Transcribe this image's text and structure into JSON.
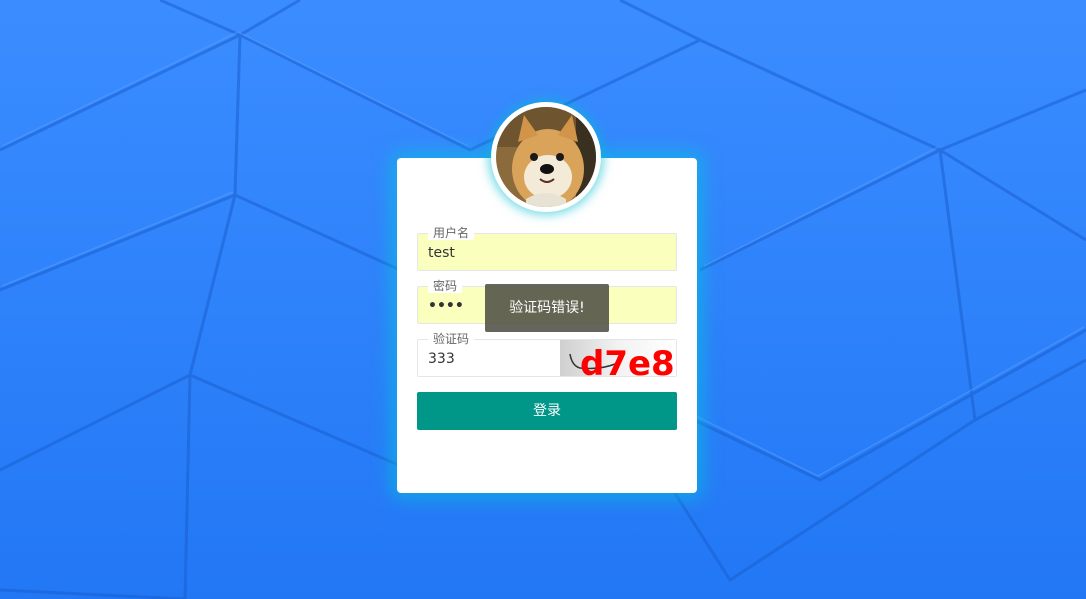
{
  "login_form": {
    "username": {
      "legend": "用户名",
      "value": "test"
    },
    "password": {
      "legend": "密码",
      "value": "••••"
    },
    "captcha": {
      "legend": "验证码",
      "value": "333",
      "image_text": "d7e8"
    },
    "submit_label": "登录"
  },
  "toast": {
    "message": "验证码错误!"
  },
  "colors": {
    "background": "#2a82ff",
    "button": "#009688",
    "autofill": "#faffbd",
    "captcha_text": "#ff0000"
  },
  "icons": {
    "avatar": "shiba-dog-avatar"
  }
}
